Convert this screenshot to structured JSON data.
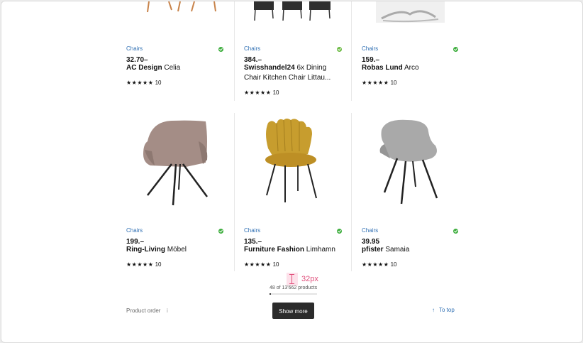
{
  "products": [
    {
      "category": "Chairs",
      "price": "32.70–",
      "brand": "AC Design",
      "name": "Celia",
      "stars": "★★★★★",
      "reviews": "10",
      "stock": "in-stock"
    },
    {
      "category": "Chairs",
      "price": "384.–",
      "brand": "Swisshandel24",
      "name": "6x Dining Chair Kitchen Chair Littau...",
      "stars": "★★★★★",
      "reviews": "10",
      "stock": "partial"
    },
    {
      "category": "Chairs",
      "price": "159.–",
      "brand": "Robas Lund",
      "name": "Arco",
      "stars": "★★★★★",
      "reviews": "10",
      "stock": "in-stock"
    },
    {
      "category": "Chairs",
      "price": "199.–",
      "brand": "Ring-Living",
      "name": "Möbel",
      "stars": "★★★★★",
      "reviews": "10",
      "stock": "in-stock"
    },
    {
      "category": "Chairs",
      "price": "135.–",
      "brand": "Furniture Fashion",
      "name": "Limhamn",
      "stars": "★★★★★",
      "reviews": "10",
      "stock": "in-stock"
    },
    {
      "category": "Chairs",
      "price": "39.95",
      "brand": "pfister",
      "name": "Samaia",
      "stars": "★★★★★",
      "reviews": "10",
      "stock": "in-stock"
    }
  ],
  "pagination": {
    "count_text": "48 of 13'662 products",
    "progress": 0.0035,
    "show_more": "Show more"
  },
  "measure_label": "32px",
  "footer": {
    "product_order": "Product order",
    "info_icon": "i",
    "to_top": "To top",
    "to_top_arrow": "↑"
  },
  "colors": {
    "accent": "#2f6fb3",
    "in_stock": "#3fae3f",
    "button_bg": "#2b2b2b",
    "measure": "#e0507c"
  }
}
